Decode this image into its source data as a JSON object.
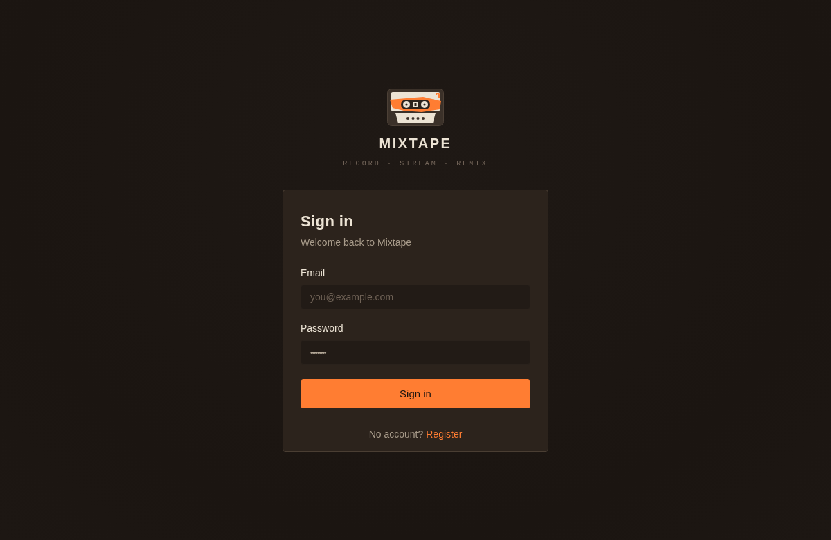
{
  "brand": {
    "name": "MIXTAPE",
    "tagline": "RECORD · STREAM · REMIX"
  },
  "card": {
    "title": "Sign in",
    "subtitle": "Welcome back to Mixtape",
    "fields": [
      {
        "label": "Email",
        "placeholder": "you@example.com"
      },
      {
        "label": "Password",
        "value": "•••••••••"
      }
    ],
    "submit": "Sign in",
    "footer": {
      "text": "No account?",
      "link": "Register"
    }
  }
}
